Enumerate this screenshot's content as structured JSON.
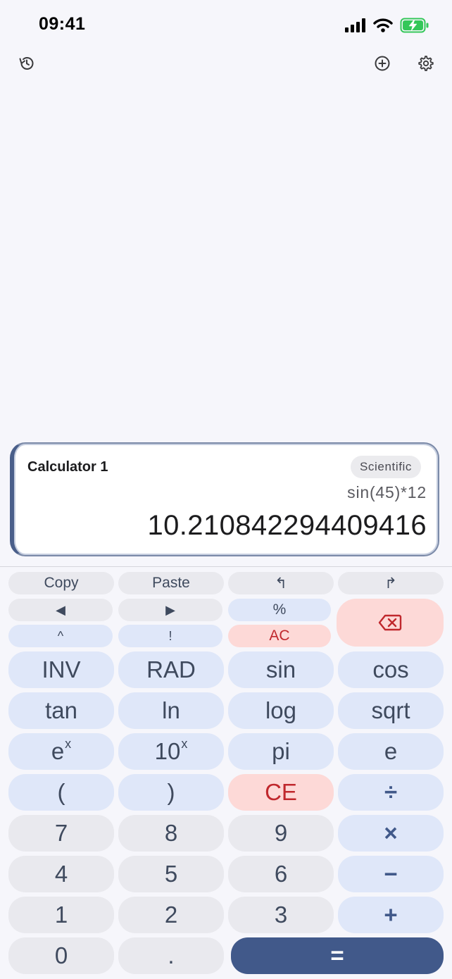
{
  "status_bar": {
    "time": "09:41"
  },
  "card": {
    "title": "Calculator 1",
    "mode": "Scientific",
    "expression": "sin(45)*12",
    "result": "10.210842294409416"
  },
  "keys": {
    "copy": "Copy",
    "paste": "Paste",
    "undo": "↰",
    "redo": "↱",
    "cursor_left": "◀",
    "cursor_right": "▶",
    "percent": "%",
    "power": "^",
    "factorial": "!",
    "all_clear": "AC",
    "inv": "INV",
    "rad": "RAD",
    "sin": "sin",
    "cos": "cos",
    "tan": "tan",
    "ln": "ln",
    "log": "log",
    "sqrt": "sqrt",
    "exp_base": "e",
    "exp_sup": "x",
    "ten_base": "10",
    "ten_sup": "x",
    "pi": "pi",
    "e": "e",
    "paren_open": "(",
    "paren_close": ")",
    "clear_entry": "CE",
    "divide": "÷",
    "seven": "7",
    "eight": "8",
    "nine": "9",
    "multiply": "×",
    "four": "4",
    "five": "5",
    "six": "6",
    "minus": "−",
    "one": "1",
    "two": "2",
    "three": "3",
    "plus": "+",
    "zero": "0",
    "decimal": ".",
    "equals": "="
  },
  "colors": {
    "accent": "#41598a",
    "function_key": "#dfe7f9",
    "digit_key": "#e9e9ee",
    "danger_key": "#fdd9d7",
    "danger_text": "#c0282d",
    "battery": "#34c759"
  },
  "icons": {
    "history": "history-icon",
    "add": "add-circle-icon",
    "settings": "gear-icon",
    "backspace": "backspace-icon",
    "signal": "cellular-signal-icon",
    "wifi": "wifi-icon",
    "battery": "battery-charging-icon"
  }
}
